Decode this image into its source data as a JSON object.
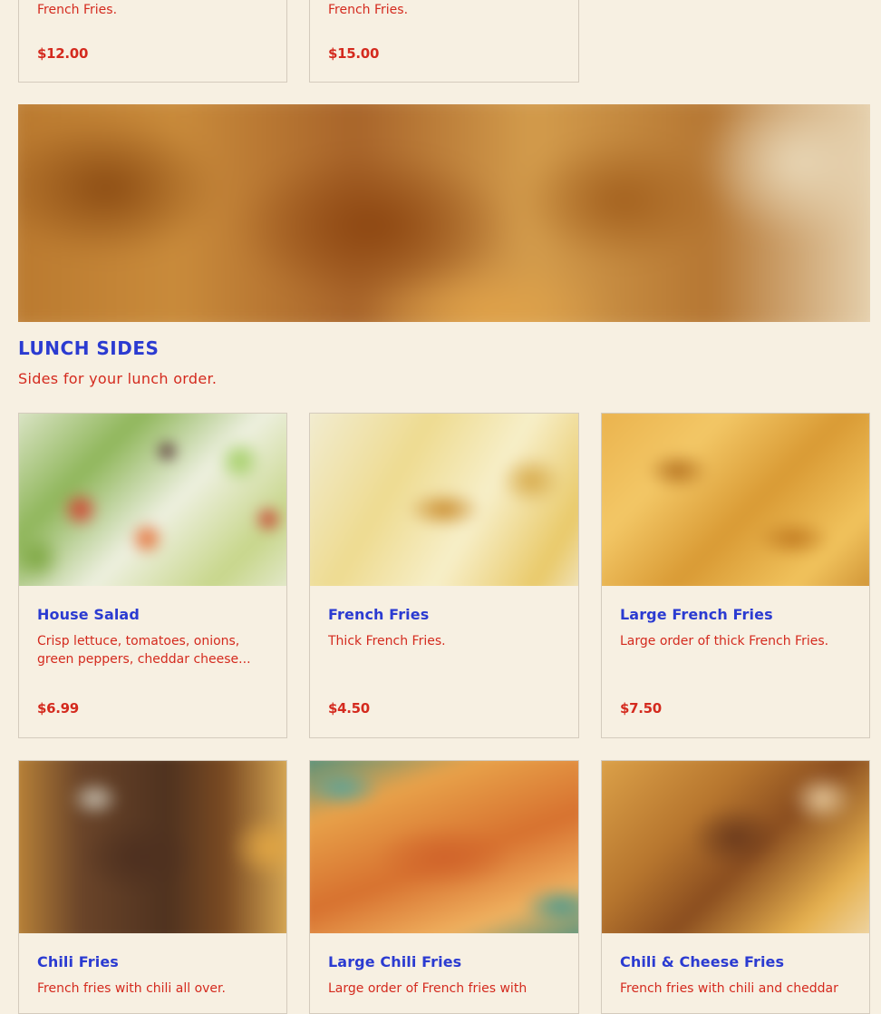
{
  "top_items": [
    {
      "desc": "French Fries.",
      "price": "$12.00"
    },
    {
      "desc": "French Fries.",
      "price": "$15.00"
    }
  ],
  "section": {
    "title": "LUNCH SIDES",
    "subtitle": "Sides for your lunch order."
  },
  "items": [
    {
      "name": "House Salad",
      "desc": "Crisp lettuce, tomatoes, onions, green peppers, cheddar cheese...",
      "price": "$6.99",
      "image": "salad-photo"
    },
    {
      "name": "French Fries",
      "desc": "Thick French Fries.",
      "price": "$4.50",
      "image": "french-fries-photo"
    },
    {
      "name": "Large French Fries",
      "desc": "Large order of thick French Fries.",
      "price": "$7.50",
      "image": "large-french-fries-photo"
    },
    {
      "name": "Chili Fries",
      "desc": "French fries with chili all over.",
      "price": "",
      "image": "chili-fries-photo"
    },
    {
      "name": "Large Chili Fries",
      "desc": "Large order of French fries with",
      "price": "",
      "image": "large-chili-fries-photo"
    },
    {
      "name": "Chili & Cheese Fries",
      "desc": "French fries with chili and cheddar",
      "price": "",
      "image": "chili-cheese-fries-photo"
    }
  ],
  "colors": {
    "background": "#f7f0e2",
    "title": "#2b3bd1",
    "accent": "#d42a1e",
    "border": "#d4cbbd"
  }
}
